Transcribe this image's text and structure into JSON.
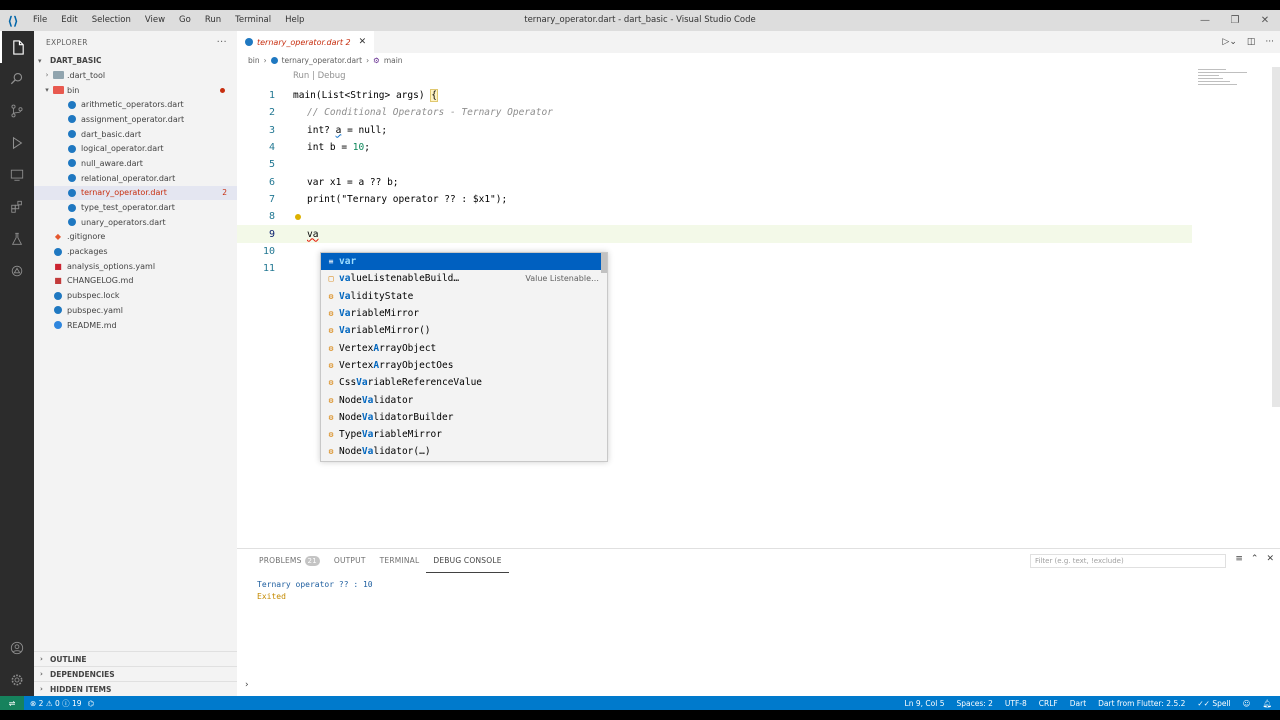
{
  "window": {
    "title": "ternary_operator.dart - dart_basic - Visual Studio Code",
    "menu": [
      "File",
      "Edit",
      "Selection",
      "View",
      "Go",
      "Run",
      "Terminal",
      "Help"
    ],
    "controls": [
      "—",
      "❐",
      "✕"
    ]
  },
  "explorer": {
    "header": "EXPLORER",
    "more": "···",
    "root": "DART_BASIC",
    "items": [
      {
        "label": ".dart_tool",
        "type": "folder",
        "depth": 1,
        "expanded": false,
        "color": "#90a4ae"
      },
      {
        "label": "bin",
        "type": "folder",
        "depth": 1,
        "expanded": true,
        "color": "#e8594f",
        "error": true
      },
      {
        "label": "arithmetic_operators.dart",
        "type": "dart",
        "depth": 2
      },
      {
        "label": "assignment_operator.dart",
        "type": "dart",
        "depth": 2
      },
      {
        "label": "dart_basic.dart",
        "type": "dart",
        "depth": 2
      },
      {
        "label": "logical_operator.dart",
        "type": "dart",
        "depth": 2
      },
      {
        "label": "null_aware.dart",
        "type": "dart",
        "depth": 2
      },
      {
        "label": "relational_operator.dart",
        "type": "dart",
        "depth": 2
      },
      {
        "label": "ternary_operator.dart",
        "type": "dart",
        "depth": 2,
        "selected": true,
        "badge": "2"
      },
      {
        "label": "type_test_operator.dart",
        "type": "dart",
        "depth": 2
      },
      {
        "label": "unary_operators.dart",
        "type": "dart",
        "depth": 2
      },
      {
        "label": ".gitignore",
        "type": "git",
        "depth": 1
      },
      {
        "label": ".packages",
        "type": "dart",
        "depth": 1
      },
      {
        "label": "analysis_options.yaml",
        "type": "yaml",
        "depth": 1
      },
      {
        "label": "CHANGELOG.md",
        "type": "md",
        "depth": 1
      },
      {
        "label": "pubspec.lock",
        "type": "dart",
        "depth": 1
      },
      {
        "label": "pubspec.yaml",
        "type": "dart",
        "depth": 1
      },
      {
        "label": "README.md",
        "type": "info",
        "depth": 1
      }
    ],
    "sections": [
      "OUTLINE",
      "DEPENDENCIES",
      "HIDDEN ITEMS"
    ]
  },
  "editor": {
    "tab": {
      "title": "ternary_operator.dart",
      "problems": "2"
    },
    "breadcrumb": [
      "bin",
      "ternary_operator.dart",
      "main"
    ],
    "codelens": "Run | Debug",
    "lines": [
      {
        "n": "1"
      },
      {
        "n": "2"
      },
      {
        "n": "3"
      },
      {
        "n": "4"
      },
      {
        "n": "5"
      },
      {
        "n": "6"
      },
      {
        "n": "7"
      },
      {
        "n": "8"
      },
      {
        "n": "9"
      },
      {
        "n": "10"
      },
      {
        "n": "11"
      }
    ],
    "code": {
      "l1_a": "main(List<String> args) ",
      "l1_b": "{",
      "l2": "// Conditional Operators - Ternary Operator",
      "l3_a": "int? ",
      "l3_b": "a",
      "l3_c": " = null;",
      "l4_a": "int b = ",
      "l4_b": "10",
      "l4_c": ";",
      "l6": "var x1 = a ?? b;",
      "l7_a": "print(",
      "l7_b": "\"Ternary operator ?? : $x1\"",
      "l7_c": ");",
      "l9": "va"
    }
  },
  "suggest": {
    "items": [
      {
        "icon": "≡",
        "hl": "var",
        "rest": "",
        "selected": true
      },
      {
        "icon": "□",
        "hl": "va",
        "rest": "lueListenableBuild…",
        "detail": "Value Listenable…"
      },
      {
        "icon": "⚙",
        "hl": "Va",
        "rest": "lidityState"
      },
      {
        "icon": "⚙",
        "hl": "Va",
        "rest": "riableMirror"
      },
      {
        "icon": "⚙",
        "hl": "Va",
        "rest": "riableMirror()"
      },
      {
        "icon": "⚙",
        "pre": "Vertex",
        "hl": "A",
        "rest": "rrayObject"
      },
      {
        "icon": "⚙",
        "pre": "Vertex",
        "hl": "A",
        "rest": "rrayObjectOes"
      },
      {
        "icon": "⚙",
        "pre": "Css",
        "hl": "Va",
        "rest": "riableReferenceValue"
      },
      {
        "icon": "⚙",
        "pre": "Node",
        "hl": "Va",
        "rest": "lidator"
      },
      {
        "icon": "⚙",
        "pre": "Node",
        "hl": "Va",
        "rest": "lidatorBuilder"
      },
      {
        "icon": "⚙",
        "pre": "Type",
        "hl": "Va",
        "rest": "riableMirror"
      },
      {
        "icon": "⚙",
        "pre": "Node",
        "hl": "Va",
        "rest": "lidator(…)"
      }
    ]
  },
  "panel": {
    "tabs": [
      "PROBLEMS",
      "OUTPUT",
      "TERMINAL",
      "DEBUG CONSOLE"
    ],
    "problems_count": "21",
    "active_tab": "DEBUG CONSOLE",
    "filter_placeholder": "Filter (e.g. text, !exclude)",
    "output": [
      "Ternary operator ?? : 10",
      "Exited"
    ],
    "prompt": "›"
  },
  "statusbar": {
    "errors": "2",
    "warnings": "0",
    "info": "19",
    "position": "Ln 9, Col 5",
    "spaces": "Spaces: 2",
    "encoding": "UTF-8",
    "eol": "CRLF",
    "language": "Dart",
    "sdk": "Dart from Flutter: 2.5.2",
    "spell": "Spell"
  },
  "colors": {
    "accent": "#007acc",
    "error": "#c72e0f",
    "selection": "#0060c0"
  }
}
